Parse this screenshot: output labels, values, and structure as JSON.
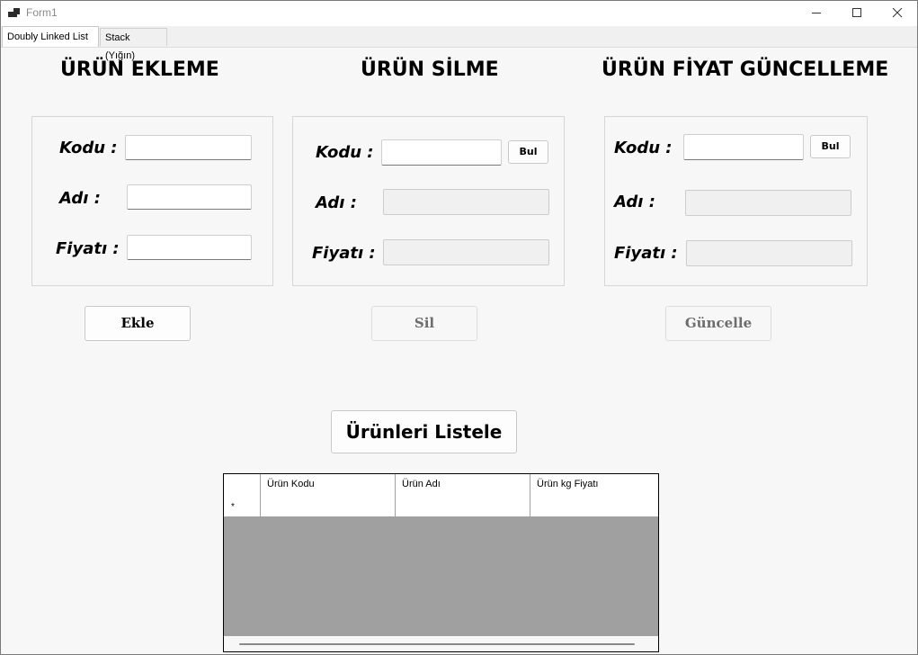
{
  "window": {
    "title": "Form1"
  },
  "tabs": [
    {
      "label": "Doubly Linked List",
      "active": true
    },
    {
      "label": "Stack (Yığın)",
      "active": false
    }
  ],
  "add_section": {
    "title": "ÜRÜN EKLEME",
    "code_label": "Kodu :",
    "name_label": "Adı :",
    "price_label": "Fiyatı :",
    "code_value": "",
    "name_value": "",
    "price_value": "",
    "button_label": "Ekle"
  },
  "delete_section": {
    "title": "ÜRÜN SİLME",
    "code_label": "Kodu :",
    "name_label": "Adı :",
    "price_label": "Fiyatı :",
    "find_label": "Bul",
    "button_label": "Sil"
  },
  "update_section": {
    "title": "ÜRÜN FİYAT GÜNCELLEME",
    "code_label": "Kodu :",
    "name_label": "Adı :",
    "price_label": "Fiyatı :",
    "find_label": "Bul",
    "button_label": "Güncelle"
  },
  "list_button_label": "Ürünleri Listele",
  "grid": {
    "columns": [
      "Ürün Kodu",
      "Ürün Adı",
      "Ürün kg Fiyatı"
    ],
    "new_row_marker": "*"
  }
}
